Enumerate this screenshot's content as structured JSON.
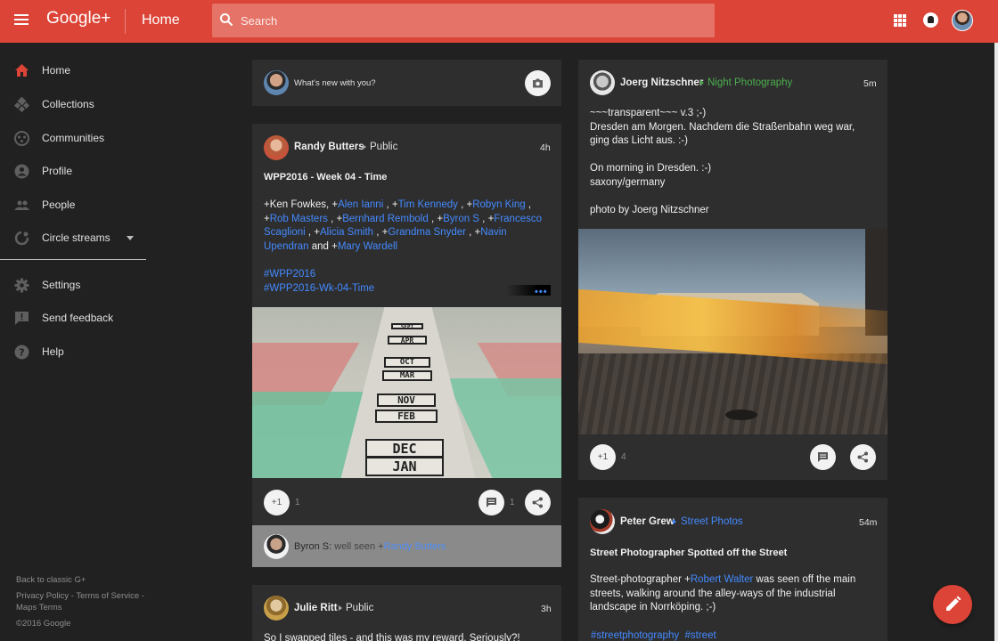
{
  "header": {
    "brand": "Google+",
    "title": "Home",
    "search_placeholder": "Search",
    "accent": "#db4437"
  },
  "sidebar": {
    "items": [
      {
        "label": "Home",
        "icon": "home-icon",
        "active": true
      },
      {
        "label": "Collections",
        "icon": "collections-icon"
      },
      {
        "label": "Communities",
        "icon": "communities-icon"
      },
      {
        "label": "Profile",
        "icon": "profile-icon"
      },
      {
        "label": "People",
        "icon": "people-icon"
      },
      {
        "label": "Circle streams",
        "icon": "circle-streams-icon",
        "has_dropdown": true
      },
      {
        "label": "Settings",
        "icon": "settings-icon"
      },
      {
        "label": "Send feedback",
        "icon": "feedback-icon"
      },
      {
        "label": "Help",
        "icon": "help-icon"
      }
    ],
    "footer": {
      "classic": "Back to classic G+",
      "privacy": "Privacy Policy",
      "dash1": " - ",
      "terms": "Terms of Service",
      "dash2": " -",
      "maps_terms": "Maps Terms",
      "copyright": "©2016 Google"
    }
  },
  "composer": {
    "prompt": "What's new with you?",
    "camera_icon": "camera-icon"
  },
  "posts": {
    "randy": {
      "author": "Randy Butters",
      "visibility": "Public",
      "time": "4h",
      "title": "WPP2016 - Week 04 - Time",
      "mentions": {
        "plain1": "+Ken Fowkes,  +",
        "p1": "Alen Ianni",
        "s1": " , +",
        "p2": "Tim Kennedy",
        "s2": " ,  +",
        "p3": "Robyn King",
        "s3": " , +",
        "p4": "Rob Masters",
        "s4": " ,  +",
        "p5": "Bernhard Rembold",
        "s5": " , +",
        "p6": "Byron S",
        "s6": " ,  +",
        "p7": "Francesco Scaglioni",
        "s7": " , +",
        "p8": "Alicia Smith",
        "s8": " , +",
        "p9": "Grandma Snyder",
        "s9": " , +",
        "p10": "Navin Upendran",
        "s10": " and +",
        "p11": "Mary Wardell"
      },
      "hashtags": [
        "#WPP2016",
        "#WPP2016-Wk-04-Time"
      ],
      "plaques": [
        "SEPT",
        "APR",
        "OCT",
        "MAR",
        "NOV",
        "FEB",
        "DEC",
        "JAN"
      ],
      "plus_label": "+1",
      "plus_count": "1",
      "comment_count": "1",
      "comment": {
        "author": "Byron S:",
        "text": " well seen +",
        "mention": "Randy Butters"
      }
    },
    "julie": {
      "author": "Julie Ritt",
      "visibility": "Public",
      "time": "3h",
      "preview": "So I swapped tiles - and this was my reward. Seriously?!"
    },
    "joerg": {
      "author": "Joerg Nitzschner",
      "community": "Night Photography",
      "community_color": "#4caf50",
      "time": "5m",
      "lines": [
        "~~~transparent~~~ v.3 ;-)",
        "Dresden am Morgen. Nachdem die Straßenbahn weg war, ging das Licht aus. :-)",
        "On morning in Dresden. :-)",
        "saxony/germany",
        "photo by Joerg Nitzschner"
      ],
      "plus_label": "+1",
      "plus_count": "4"
    },
    "peter": {
      "author": "Peter Grew",
      "community": "Street Photos",
      "community_color": "#448aff",
      "time": "54m",
      "title": "Street Photographer Spotted off the Street",
      "body_pre": "Street-photographer +",
      "mention": "Robert Walter",
      "body_post": " was seen off the main streets, walking around the alley-ways of the industrial landscape in Norrköping. ;-)",
      "hashtags": [
        "#streetphotography",
        "#street"
      ]
    }
  },
  "fab": {
    "icon": "pencil-icon"
  }
}
